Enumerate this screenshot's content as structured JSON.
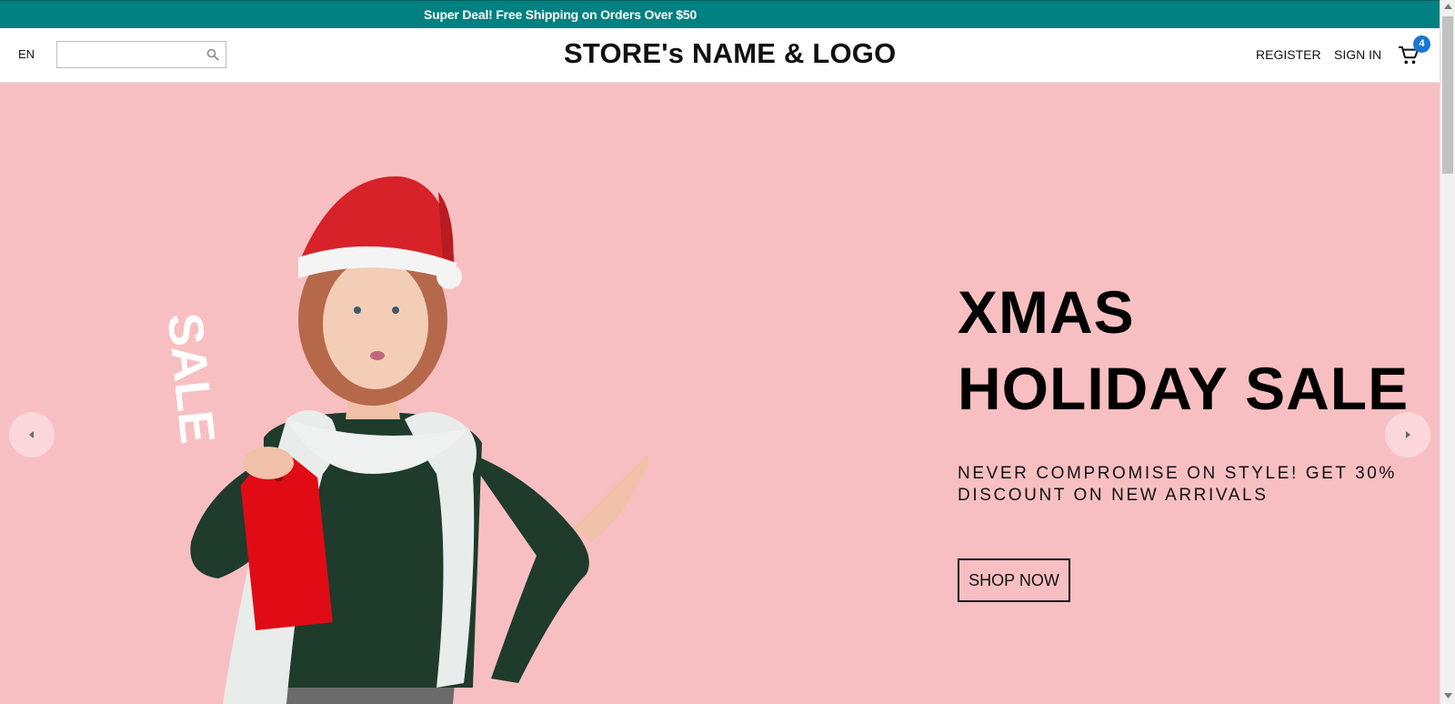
{
  "announcement": {
    "text": "Super Deal! Free Shipping on Orders Over $50"
  },
  "header": {
    "language": "EN",
    "search": {
      "value": "",
      "placeholder": ""
    },
    "logo_text": "STORE's NAME & LOGO",
    "register_label": "REGISTER",
    "signin_label": "SIGN IN",
    "cart_count": "4"
  },
  "hero": {
    "heading_line1": "XMAS",
    "heading_line2": "HOLIDAY SALE",
    "subheading": "NEVER COMPROMISE ON STYLE! GET 30% DISCOUNT ON NEW ARRIVALS",
    "cta_label": "SHOP NOW",
    "sale_tag_text": "SALE"
  },
  "colors": {
    "announcement_bg": "#008080",
    "hero_bg": "#f8bfc2",
    "cart_badge": "#1976d2",
    "text": "#111111"
  },
  "icons": {
    "search": "search-icon",
    "cart": "cart-icon",
    "prev": "chevron-left-icon",
    "next": "chevron-right-icon"
  }
}
